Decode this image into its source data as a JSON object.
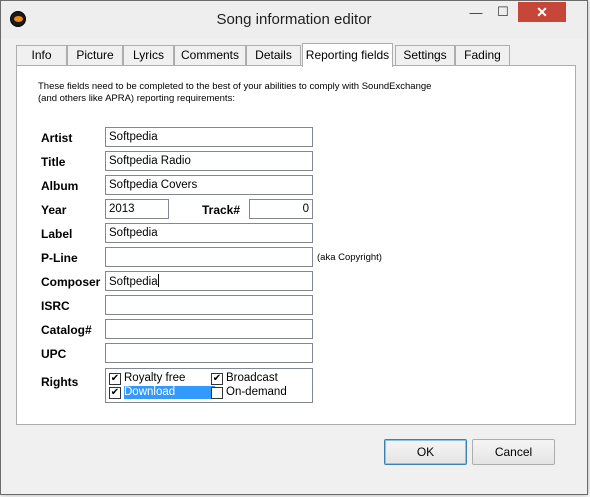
{
  "window": {
    "title": "Song information editor",
    "min_glyph": "—",
    "max_glyph": "☐",
    "close_glyph": "✕"
  },
  "tabs": [
    {
      "label": "Info"
    },
    {
      "label": "Picture"
    },
    {
      "label": "Lyrics"
    },
    {
      "label": "Comments"
    },
    {
      "label": "Details"
    },
    {
      "label": "Reporting fields",
      "active": true
    },
    {
      "label": "Settings"
    },
    {
      "label": "Fading"
    }
  ],
  "intro": {
    "line1": "These fields need to be completed to the best of your abilities to comply with SoundExchange",
    "line2": "(and others like APRA) reporting requirements:"
  },
  "fields": {
    "artist": {
      "label": "Artist",
      "value": "Softpedia"
    },
    "title": {
      "label": "Title",
      "value": "Softpedia Radio"
    },
    "album": {
      "label": "Album",
      "value": "Softpedia Covers"
    },
    "year": {
      "label": "Year",
      "value": "2013"
    },
    "track": {
      "label": "Track#",
      "value": "0"
    },
    "label": {
      "label": "Label",
      "value": "Softpedia"
    },
    "pline": {
      "label": "P-Line",
      "value": "",
      "note": "(aka Copyright)"
    },
    "composer": {
      "label": "Composer",
      "value": "Softpedia"
    },
    "isrc": {
      "label": "ISRC",
      "value": ""
    },
    "catalog": {
      "label": "Catalog#",
      "value": ""
    },
    "upc": {
      "label": "UPC",
      "value": ""
    }
  },
  "rights": {
    "label": "Rights",
    "options": [
      {
        "text": "Royalty free",
        "checked": true
      },
      {
        "text": "Broadcast",
        "checked": true
      },
      {
        "text": "Download",
        "checked": true,
        "selected": true
      },
      {
        "text": "On-demand",
        "checked": false
      }
    ]
  },
  "buttons": {
    "ok": "OK",
    "cancel": "Cancel"
  },
  "icons": {
    "app": "app-logo-icon",
    "check": "✔"
  }
}
